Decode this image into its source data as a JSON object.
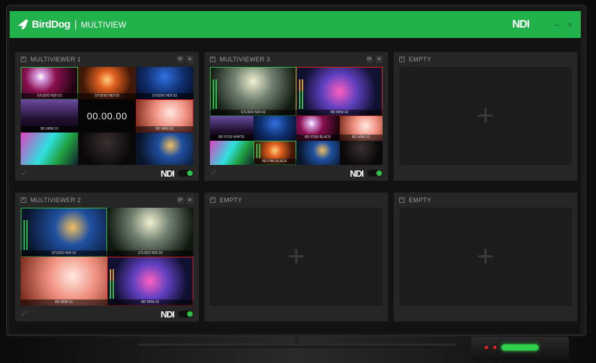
{
  "header": {
    "brand": "BirdDog",
    "separator": "|",
    "app": "MULTIVIEW",
    "ndi": "NDI",
    "minimize": "–",
    "close": "×"
  },
  "colors": {
    "header": "#21b24b",
    "program": "#2fc24a",
    "preview": "#e02020"
  },
  "panels": [
    {
      "title": "MULTIVIEWER 1",
      "layout": "3x3",
      "ndi": "NDI",
      "enabled": true,
      "tiles": [
        {
          "label": "STUDIO NDI 01",
          "c": "c0",
          "b": "g"
        },
        {
          "label": "STUDIO NDI 02",
          "c": "c1"
        },
        {
          "label": "STUDIO NDI 03",
          "c": "c2"
        },
        {
          "label": "BD MINI 01",
          "c": "c3"
        },
        {
          "timer": "00.00.00"
        },
        {
          "label": "BD MINI 02",
          "c": "c4",
          "b": "r"
        },
        {
          "label": "",
          "c": "c5"
        },
        {
          "label": "",
          "c": "c6"
        },
        {
          "label": "",
          "c": "c7"
        }
      ]
    },
    {
      "title": "MULTIVIEWER 3",
      "layout": "2+8",
      "ndi": "NDI",
      "enabled": true,
      "tiles": [
        {
          "label": "STUDIO NDI 02",
          "c": "c8",
          "b": "g",
          "m": "g"
        },
        {
          "label": "BD MINI 02",
          "c": "c9",
          "b": "r",
          "m": "o"
        },
        {
          "label": "BD P100 WHITE",
          "c": "c3"
        },
        {
          "label": "",
          "c": "c2"
        },
        {
          "label": "BD P200 BLACK",
          "c": "c0"
        },
        {
          "label": "BD MINI 01",
          "c": "c4"
        },
        {
          "label": "",
          "c": "c5"
        },
        {
          "label": "BD P4K BLACK",
          "c": "c1",
          "b": "g",
          "m": "g"
        },
        {
          "label": "",
          "c": "c7"
        },
        {
          "label": "",
          "c": "c6"
        }
      ]
    },
    {
      "title": "EMPTY",
      "empty": true,
      "plus": "+"
    },
    {
      "title": "MULTIVIEWER 2",
      "layout": "2x2",
      "ndi": "NDI",
      "enabled": true,
      "tiles": [
        {
          "label": "STUDIO NDI 01",
          "c": "c7",
          "b": "g",
          "m": "g"
        },
        {
          "label": "STUDIO NDI 02",
          "c": "c8"
        },
        {
          "label": "BD MINI 01",
          "c": "c4"
        },
        {
          "label": "BD MINI 02",
          "c": "c9",
          "b": "r",
          "m": "o"
        }
      ]
    },
    {
      "title": "EMPTY",
      "empty": true,
      "plus": "+"
    },
    {
      "title": "EMPTY",
      "empty": true,
      "plus": "+"
    }
  ]
}
